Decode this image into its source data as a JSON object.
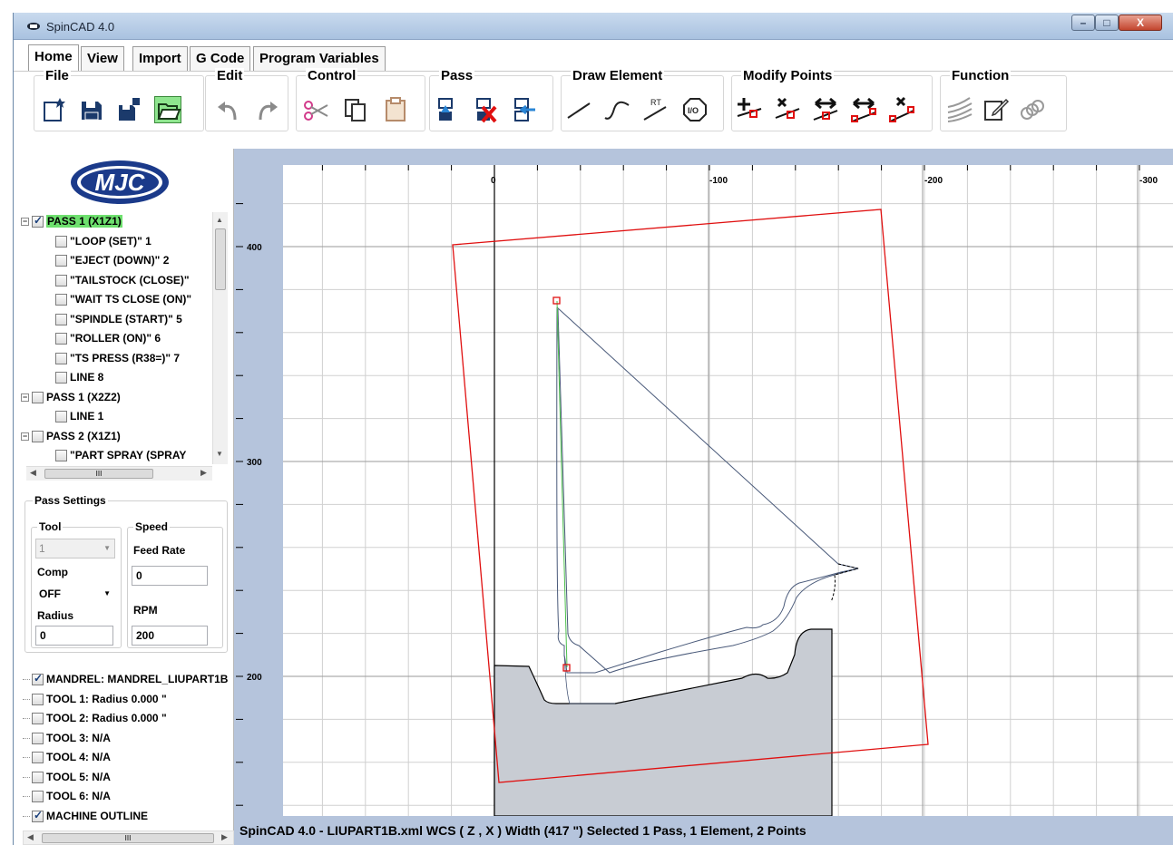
{
  "window": {
    "title": "SpinCAD 4.0",
    "min": "–",
    "max": "□",
    "close": "X"
  },
  "tabs": [
    "Home",
    "View",
    "Import",
    "G Code",
    "Program Variables"
  ],
  "ribbon": {
    "groups": [
      "File",
      "Edit",
      "Control",
      "Pass",
      "Draw Element",
      "Modify Points",
      "Function"
    ],
    "rt_label": "RT",
    "io_label": "I/O"
  },
  "logo": "MJC",
  "tree": {
    "nodes": [
      "PASS 1 (X1Z1)",
      "\"LOOP (SET)\" 1",
      "\"EJECT (DOWN)\" 2",
      "\"TAILSTOCK (CLOSE)\"",
      "\"WAIT TS CLOSE (ON)\"",
      "\"SPINDLE (START)\" 5",
      "\"ROLLER (ON)\" 6",
      "\"TS PRESS (R38=)\" 7",
      "LINE 8",
      "PASS 1 (X2Z2)",
      "LINE 1",
      "PASS 2 (X1Z1)",
      "\"PART SPRAY (SPRAY"
    ],
    "hscroll_mark": "III"
  },
  "pass_settings": {
    "title": "Pass Settings",
    "tool_label": "Tool",
    "tool_value": "1",
    "comp_label": "Comp",
    "comp_value": "OFF",
    "radius_label": "Radius",
    "radius_value": "0",
    "speed_label": "Speed",
    "feed_label": "Feed Rate",
    "feed_value": "0",
    "rpm_label": "RPM",
    "rpm_value": "200"
  },
  "tools": [
    {
      "label": "MANDREL: MANDREL_LIUPART1B",
      "checked": true
    },
    {
      "label": "TOOL 1: Radius 0.000 \"",
      "checked": false
    },
    {
      "label": "TOOL 2: Radius 0.000 \"",
      "checked": false
    },
    {
      "label": "TOOL 3: N/A",
      "checked": false
    },
    {
      "label": "TOOL 4: N/A",
      "checked": false
    },
    {
      "label": "TOOL 5: N/A",
      "checked": false
    },
    {
      "label": "TOOL 6: N/A",
      "checked": false
    },
    {
      "label": "MACHINE OUTLINE",
      "checked": true
    }
  ],
  "canvas": {
    "ruler_top": [
      "0",
      "-100",
      "-200",
      "-300"
    ],
    "ruler_left": [
      "400",
      "300",
      "200"
    ]
  },
  "status": "SpinCAD 4.0 - LIUPART1B.xml  WCS ( Z , X )  Width (417 \")  Selected 1 Pass, 1 Element, 2 Points",
  "colors": {
    "canvas_bg": "#b5c4dc",
    "machine_outline": "#e01010",
    "toolpath": "#4a5a7a",
    "mandrel_fill": "#c8ccd3",
    "selected_pass": "#6ee06e"
  }
}
